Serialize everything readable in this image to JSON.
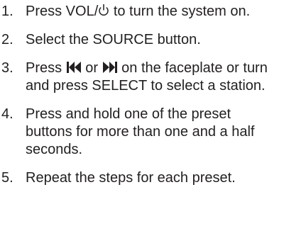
{
  "steps": [
    {
      "number": "1.",
      "parts": {
        "a": "Press VOL/",
        "b": " to turn the system on."
      },
      "icon": "power-icon"
    },
    {
      "number": "2.",
      "text": "Select the SOURCE button."
    },
    {
      "number": "3.",
      "parts": {
        "a": "Press ",
        "b": " or ",
        "c": " on the faceplate or turn and press SELECT to select a station."
      },
      "icons": [
        "seek-back-icon",
        "seek-forward-icon"
      ]
    },
    {
      "number": "4.",
      "text": "Press and hold one of the preset buttons for more than one and a half seconds."
    },
    {
      "number": "5.",
      "text": "Repeat the steps for each preset."
    }
  ],
  "colors": {
    "text": "#231f20",
    "background": "#ffffff"
  }
}
